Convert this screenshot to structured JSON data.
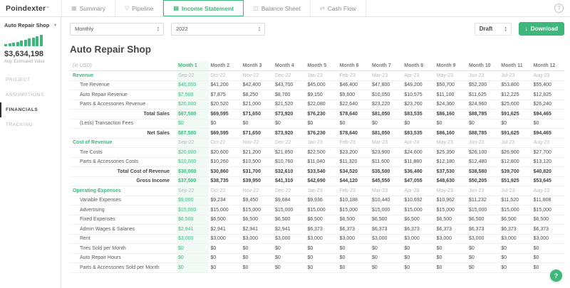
{
  "app": {
    "logo": "Poindexter",
    "logo_tm": "TM",
    "active_tab": "Income Statement",
    "tabs": [
      {
        "label": "Summary",
        "icon": "summary-icon",
        "glyph": "▦"
      },
      {
        "label": "Pipeline",
        "icon": "pipeline-icon",
        "glyph": "▽"
      },
      {
        "label": "Income Statement",
        "icon": "income-statement-icon",
        "glyph": "▤"
      },
      {
        "label": "Balance Sheet",
        "icon": "balance-sheet-icon",
        "glyph": "◫"
      },
      {
        "label": "Cash Flow",
        "icon": "cash-flow-icon",
        "glyph": "⇄"
      }
    ],
    "info_icon": "?"
  },
  "sidebar": {
    "company": "Auto Repair Shop",
    "estimated_value": "$3,634,198",
    "value_caption": "Avg. Estimated Value",
    "chart": {
      "bars": [
        3,
        4,
        5,
        6,
        8,
        9,
        11,
        12,
        14,
        16
      ]
    },
    "active_nav": "FINANCIALS",
    "nav": [
      {
        "label": "PROJECT"
      },
      {
        "label": "ASSUMPTIONS"
      },
      {
        "label": "FINANCIALS"
      },
      {
        "label": "TRACKING"
      }
    ]
  },
  "toolbar": {
    "period": "Monthly",
    "year": "2022",
    "status": "Draft",
    "download_label": "Download",
    "download_icon": "↓"
  },
  "main": {
    "title": "Auto Repair Shop"
  },
  "table": {
    "unit_label": "(in USD)",
    "columns": [
      "Month 1",
      "Month 2",
      "Month 3",
      "Month 4",
      "Month 5",
      "Month 6",
      "Month 7",
      "Month 8",
      "Month 9",
      "Month 10",
      "Month 11",
      "Month 12"
    ],
    "dates": [
      "Sep-22",
      "Oct-22",
      "Nov-22",
      "Dec-22",
      "Jan-23",
      "Feb-23",
      "Mar-23",
      "Apr-23",
      "May-23",
      "Jun-23",
      "Jul-23",
      "Aug-23"
    ],
    "accent_color": "#3eb77b",
    "rows": [
      {
        "type": "section",
        "label": "Revenue"
      },
      {
        "type": "item",
        "label": "Tire Revenue",
        "values": [
          "$40,000",
          "$41,200",
          "$42,400",
          "$43,700",
          "$45,000",
          "$46,400",
          "$47,800",
          "$49,200",
          "$50,700",
          "$52,200",
          "$53,800",
          "$55,400"
        ]
      },
      {
        "type": "item",
        "label": "Auto Repair Revenue",
        "values": [
          "$7,500",
          "$7,875",
          "$8,250",
          "$8,700",
          "$9,150",
          "$9,600",
          "$10,050",
          "$10,575",
          "$11,100",
          "$11,625",
          "$12,225",
          "$12,825"
        ]
      },
      {
        "type": "item",
        "label": "Parts & Accessories Revenue",
        "values": [
          "$20,000",
          "$20,520",
          "$21,000",
          "$21,520",
          "$22,080",
          "$22,640",
          "$23,220",
          "$23,760",
          "$24,360",
          "$24,960",
          "$25,600",
          "$26,240"
        ]
      },
      {
        "type": "total",
        "label": "Total Sales",
        "values": [
          "$67,500",
          "$69,595",
          "$71,650",
          "$73,920",
          "$76,230",
          "$78,640",
          "$81,050",
          "$83,535",
          "$86,160",
          "$88,785",
          "$91,625",
          "$94,465"
        ]
      },
      {
        "type": "item",
        "label": "(Less) Transaction Fees",
        "values": [
          "$0",
          "$0",
          "$0",
          "$0",
          "$0",
          "$0",
          "$0",
          "$0",
          "$0",
          "$0",
          "$0",
          "$0"
        ]
      },
      {
        "type": "total",
        "label": "Net Sales",
        "values": [
          "$67,500",
          "$69,595",
          "$71,650",
          "$73,920",
          "$76,230",
          "$78,640",
          "$81,050",
          "$83,535",
          "$86,160",
          "$88,785",
          "$91,625",
          "$94,465"
        ]
      },
      {
        "type": "section",
        "label": "Cost of Revenue"
      },
      {
        "type": "item",
        "label": "Tire Costs",
        "values": [
          "$20,000",
          "$20,600",
          "$21,200",
          "$21,850",
          "$22,500",
          "$23,200",
          "$23,900",
          "$24,600",
          "$25,350",
          "$26,100",
          "$26,900",
          "$27,700"
        ]
      },
      {
        "type": "item",
        "label": "Parts & Accessories Costs",
        "values": [
          "$10,000",
          "$10,260",
          "$10,500",
          "$10,760",
          "$11,040",
          "$11,320",
          "$11,600",
          "$11,880",
          "$12,180",
          "$12,480",
          "$12,800",
          "$13,120"
        ]
      },
      {
        "type": "total",
        "label": "Total Cost of Revenue",
        "values": [
          "$30,000",
          "$30,860",
          "$31,700",
          "$32,610",
          "$33,540",
          "$34,520",
          "$35,500",
          "$36,480",
          "$37,530",
          "$38,580",
          "$39,700",
          "$40,820"
        ]
      },
      {
        "type": "total",
        "label": "Gross Income",
        "values": [
          "$37,500",
          "$38,735",
          "$39,950",
          "$41,310",
          "$42,690",
          "$44,120",
          "$45,550",
          "$47,055",
          "$48,630",
          "$50,205",
          "$51,925",
          "$53,645"
        ]
      },
      {
        "type": "section",
        "label": "Operating Expenses"
      },
      {
        "type": "item",
        "label": "Variable Expenses",
        "values": [
          "$9,000",
          "$9,234",
          "$9,450",
          "$9,684",
          "$9,936",
          "$10,188",
          "$10,440",
          "$10,692",
          "$10,962",
          "$11,232",
          "$11,520",
          "$11,808"
        ]
      },
      {
        "type": "item",
        "label": "Advertising",
        "values": [
          "$15,000",
          "$15,000",
          "$15,000",
          "$15,000",
          "$15,000",
          "$15,000",
          "$15,000",
          "$15,000",
          "$15,000",
          "$15,000",
          "$15,000",
          "$15,000"
        ]
      },
      {
        "type": "item",
        "label": "Fixed Expenses",
        "values": [
          "$6,500",
          "$6,500",
          "$6,500",
          "$6,500",
          "$6,500",
          "$6,500",
          "$6,500",
          "$6,500",
          "$6,500",
          "$6,500",
          "$6,500",
          "$6,500"
        ]
      },
      {
        "type": "item",
        "label": "Admin Wages & Salaries",
        "values": [
          "$2,941",
          "$2,941",
          "$2,941",
          "$2,941",
          "$6,373",
          "$6,373",
          "$6,373",
          "$6,373",
          "$6,373",
          "$6,373",
          "$6,373",
          "$6,373"
        ]
      },
      {
        "type": "item",
        "label": "Rent",
        "values": [
          "$3,000",
          "$3,000",
          "$3,000",
          "$3,000",
          "$3,000",
          "$3,000",
          "$3,000",
          "$3,000",
          "$3,000",
          "$3,000",
          "$3,000",
          "$3,000"
        ]
      },
      {
        "type": "item",
        "label": "Tires Sold per Month",
        "values": [
          "$0",
          "$0",
          "$0",
          "$0",
          "$0",
          "$0",
          "$0",
          "$0",
          "$0",
          "$0",
          "$0",
          "$0"
        ]
      },
      {
        "type": "item",
        "label": "Auto Repair Hours",
        "values": [
          "$0",
          "$0",
          "$0",
          "$0",
          "$0",
          "$0",
          "$0",
          "$0",
          "$0",
          "$0",
          "$0",
          "$0"
        ]
      },
      {
        "type": "item",
        "label": "Parts & Accessories Sold per Month",
        "values": [
          "$0",
          "$0",
          "$0",
          "$0",
          "$0",
          "$0",
          "$0",
          "$0",
          "$0",
          "$0",
          "$0",
          "$0"
        ]
      }
    ]
  },
  "help": {
    "label": "?"
  }
}
